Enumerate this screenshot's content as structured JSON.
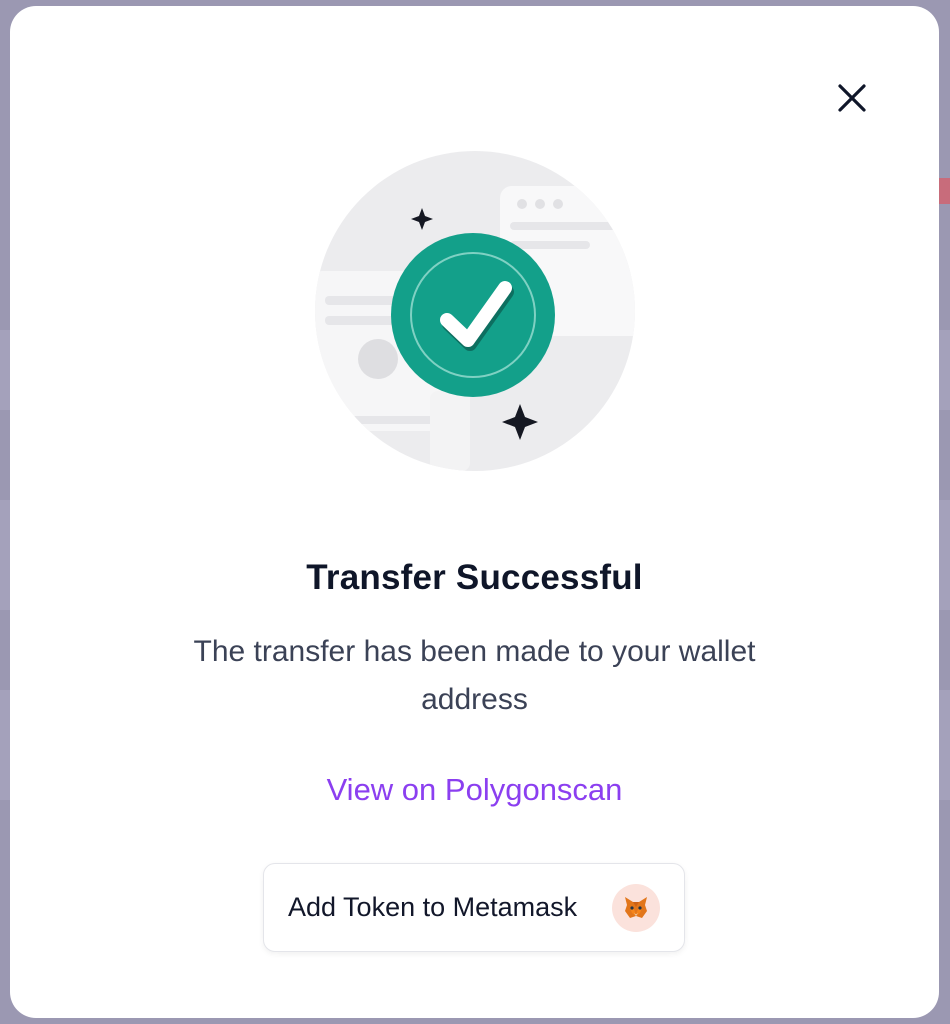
{
  "modal": {
    "title": "Transfer Successful",
    "message": "The transfer has been made to your wallet address",
    "explorer_link": "View on Polygonscan",
    "metamask_button": "Add Token to Metamask"
  },
  "icons": {
    "close": "close-icon",
    "success": "checkmark-circle-icon",
    "metamask": "metamask-fox-icon"
  },
  "colors": {
    "success_green": "#13a08a",
    "link_purple": "#8b3ff0",
    "title_dark": "#0f1629"
  }
}
